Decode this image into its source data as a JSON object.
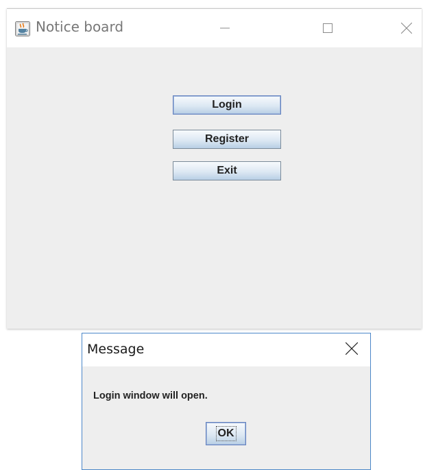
{
  "main_window": {
    "title": "Notice board",
    "app_icon": "java-cup-icon",
    "controls": [
      "minimize-icon",
      "maximize-icon",
      "close-icon"
    ],
    "buttons": {
      "login": "Login",
      "register": "Register",
      "exit": "Exit"
    }
  },
  "dialog": {
    "title": "Message",
    "close_icon": "close-icon",
    "message": "Login window will open.",
    "ok_label": "OK"
  },
  "colors": {
    "window_bg": "#eeeeee",
    "titlebar_bg": "#ffffff",
    "dialog_border": "#4a86c8",
    "button_gradient_top": "#f7fafd",
    "button_gradient_bottom": "#b8cfe5",
    "focus_border": "#6382bf"
  }
}
